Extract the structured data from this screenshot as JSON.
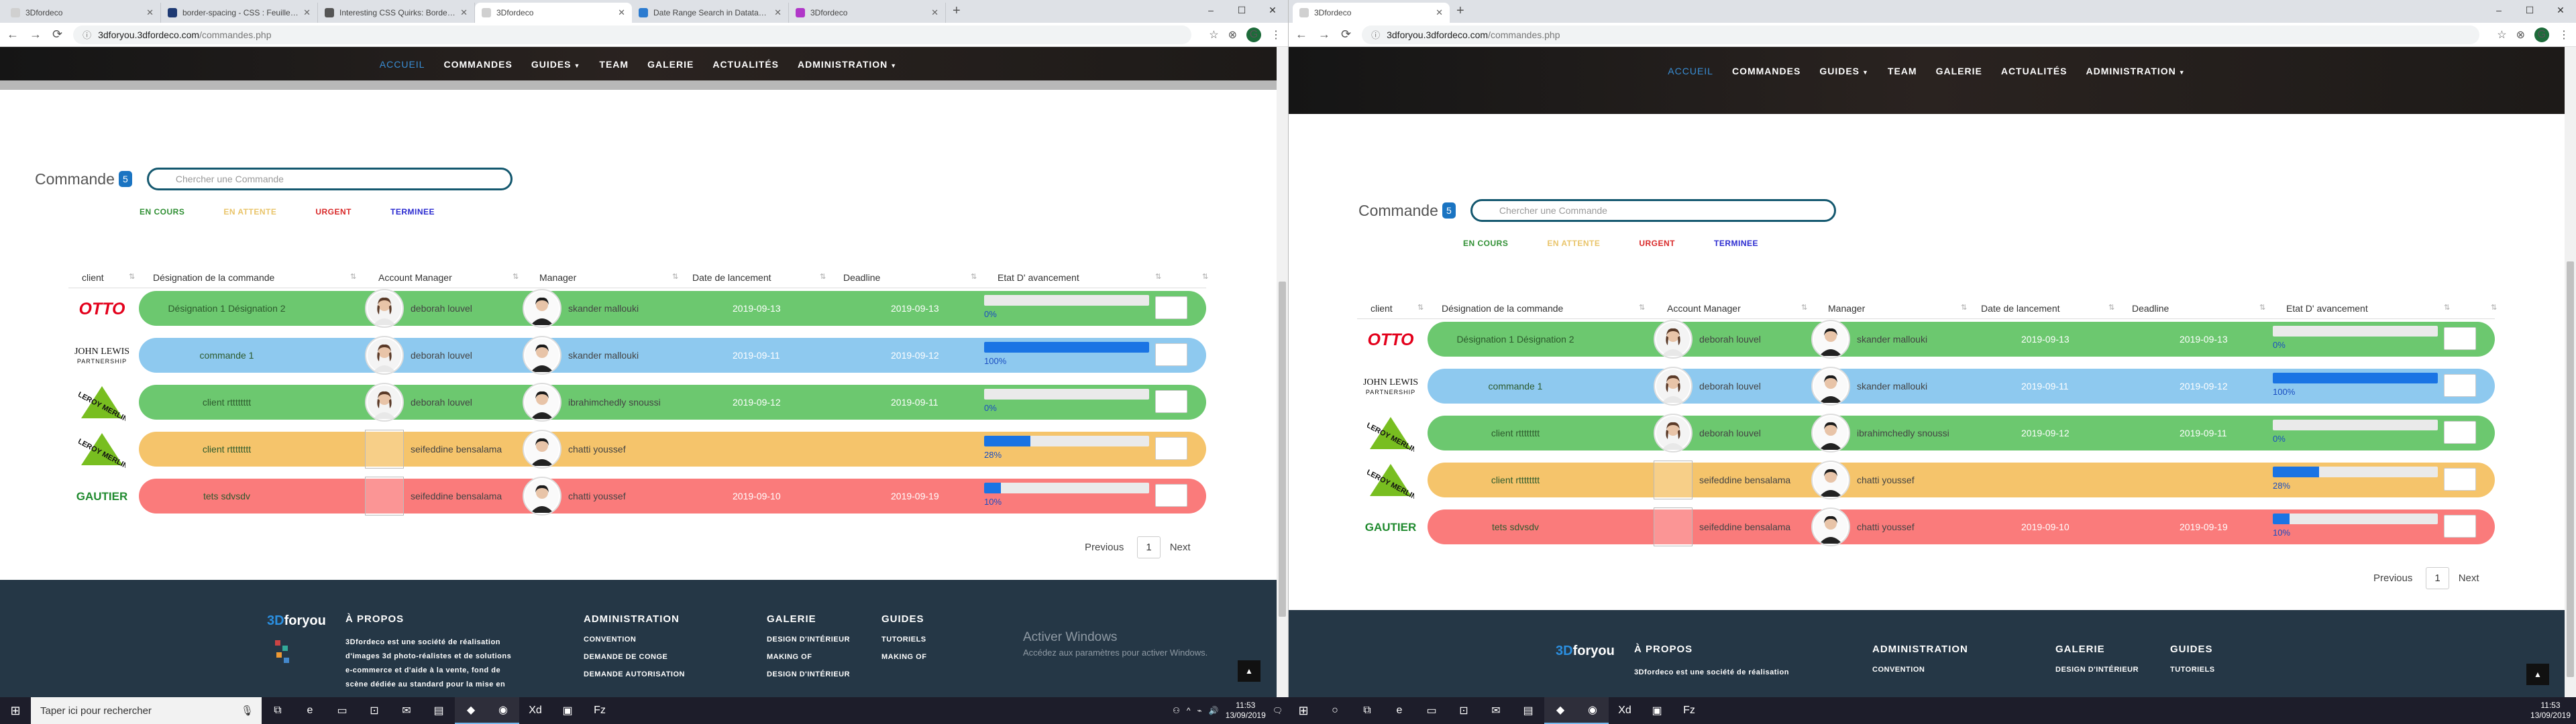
{
  "browser": {
    "window_controls": {
      "minimize": "–",
      "maximize": "☐",
      "close": "✕"
    },
    "new_tab_symbol": "+",
    "left": {
      "tabs": [
        {
          "title": "3Dfordeco",
          "active": false,
          "favicon_color": "#d0d0d0"
        },
        {
          "title": "border-spacing - CSS : Feuilles d...",
          "active": false,
          "favicon_color": "#1e3a73"
        },
        {
          "title": "Interesting CSS Quirks: Border-s...",
          "active": false,
          "favicon_color": "#555555"
        },
        {
          "title": "3Dfordeco",
          "active": true,
          "favicon_color": "#d0d0d0"
        },
        {
          "title": "Date Range Search in Datatables...",
          "active": false,
          "favicon_color": "#2b7bd0"
        },
        {
          "title": "3Dfordeco",
          "active": false,
          "favicon_color": "#b037c8"
        }
      ],
      "url_host": "3dforyou.3dfordeco.com",
      "url_path": "/commandes.php"
    },
    "right": {
      "tabs": [
        {
          "title": "3Dfordeco",
          "active": true,
          "favicon_color": "#d0d0d0"
        }
      ],
      "url_host": "3dforyou.3dfordeco.com",
      "url_path": "/commandes.php"
    },
    "profile_initial": "G"
  },
  "nav": {
    "items": [
      "ACCUEIL",
      "COMMANDES",
      "GUIDES",
      "TEAM",
      "GALERIE",
      "ACTUALITÉS",
      "ADMINISTRATION"
    ]
  },
  "commandes": {
    "title": "Commande",
    "count": "5",
    "search_placeholder": "Chercher une Commande",
    "legend": {
      "en_cours": "EN COURS",
      "en_attente": "EN ATTENTE",
      "urgent": "URGENT",
      "terminee": "TERMINEE"
    },
    "colors": {
      "en_cours": "#6cc86f",
      "en_attente": "#f5c46b",
      "urgent": "#fa7b7b",
      "terminee": "#8ec9ef"
    },
    "columns": [
      "client",
      "Désignation de la commande",
      "Account Manager",
      "Manager",
      "Date de lancement",
      "Deadline",
      "Etat D' avancement"
    ],
    "rows": [
      {
        "client": "OTTO",
        "designation": "Désignation 1 Désignation 2",
        "account_manager": "deborah louvel",
        "manager": "skander mallouki",
        "date_lancement": "2019-09-13",
        "deadline": "2019-09-13",
        "progress": 0,
        "progress_label": "0%",
        "status": "en_cours",
        "account_avatar": true
      },
      {
        "client": "JOHN LEWIS PARTNERSHIP",
        "designation": "commande 1",
        "account_manager": "deborah louvel",
        "manager": "skander mallouki",
        "date_lancement": "2019-09-11",
        "deadline": "2019-09-12",
        "progress": 100,
        "progress_label": "100%",
        "status": "terminee",
        "account_avatar": true
      },
      {
        "client": "LEROY MERLIN",
        "designation": "client rtttttttt",
        "account_manager": "deborah louvel",
        "manager": "ibrahimchedly snoussi",
        "date_lancement": "2019-09-12",
        "deadline": "2019-09-11",
        "progress": 0,
        "progress_label": "0%",
        "status": "en_cours",
        "account_avatar": true
      },
      {
        "client": "LEROY MERLIN",
        "designation": "client rtttttttt",
        "account_manager": "seifeddine bensalama",
        "manager": "chatti youssef",
        "date_lancement": "",
        "deadline": "",
        "progress": 28,
        "progress_label": "28%",
        "status": "en_attente",
        "account_avatar": false
      },
      {
        "client": "GAUTIER",
        "designation": "tets sdvsdv",
        "account_manager": "seifeddine bensalama",
        "manager": "chatti youssef",
        "date_lancement": "2019-09-10",
        "deadline": "2019-09-19",
        "progress": 10,
        "progress_label": "10%",
        "status": "urgent",
        "account_avatar": false
      }
    ],
    "pagination": {
      "previous": "Previous",
      "current": "1",
      "next": "Next"
    }
  },
  "footer": {
    "logo_prefix": "3D",
    "logo_suffix": "foryou",
    "about_title": "À PROPOS",
    "about_brand": "3Dfordeco",
    "about_text_1": " est une société de réalisation",
    "about_text_2": "d'images 3d photo-réalistes et de solutions",
    "about_text_3": "e-commerce et d'aide à la vente, fond de",
    "about_text_4": "scène dédiée au standard pour la mise en",
    "administration_title": "ADMINISTRATION",
    "administration_items": [
      "CONVENTION",
      "DEMANDE DE CONGE",
      "DEMANDE AUTORISATION"
    ],
    "galerie_title": "GALERIE",
    "galerie_items": [
      "DESIGN D'INTÉRIEUR",
      "MAKING OF",
      "DESIGN D'INTÉRIEUR"
    ],
    "guides_title": "GUIDES",
    "guides_items": [
      "TUTORIELS",
      "MAKING OF"
    ],
    "activate_title": "Activer Windows",
    "activate_sub": "Accédez aux paramètres pour activer Windows.",
    "to_top": "▲"
  },
  "taskbar": {
    "search_placeholder": "Taper ici pour rechercher",
    "time": "11:53",
    "date": "13/09/2019"
  }
}
